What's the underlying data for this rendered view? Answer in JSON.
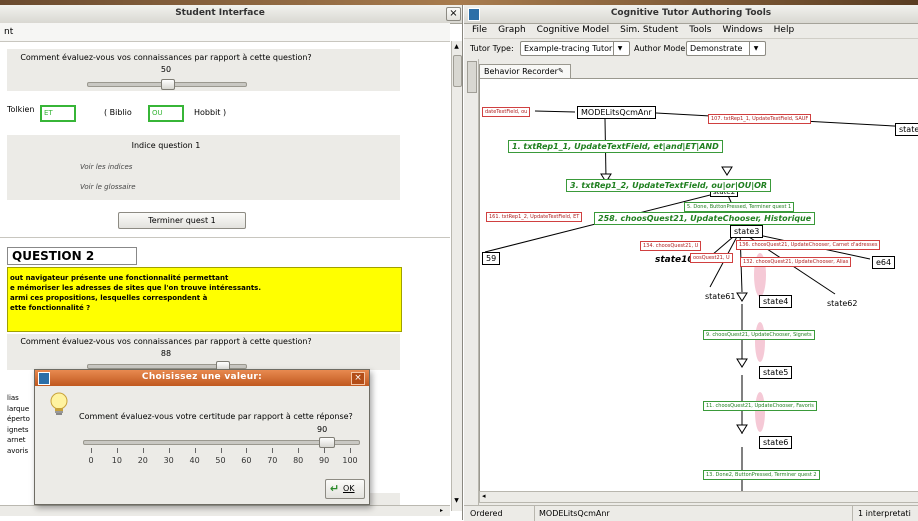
{
  "student": {
    "title": "Student Interface",
    "close_glyph": "×",
    "partial_tab": "nt",
    "q1": {
      "rating_prompt": "Comment évaluez-vous vos connaissances par rapport à cette question?",
      "rating_value": "50",
      "rating_level": 0.5,
      "tolkien": "Tolkien",
      "field1": "ET",
      "biblio": "(  Biblio",
      "field2": "OU",
      "hobbit": "Hobbit  )",
      "hint_title": "Indice question 1",
      "hint_link": "Voir les indices",
      "glossary_link": "Voir le glossaire",
      "finish_button": "Terminer quest 1"
    },
    "q2": {
      "heading": "QUESTION 2",
      "text_lines": [
        "out navigateur présente une fonctionnalité permettant",
        "e mémoriser les adresses de sites que l'on trouve intéressants.",
        "armi ces propositions, lesquelles correspondent à",
        "ette fonctionnalité ?"
      ],
      "rating_prompt": "Comment évaluez-vous vos connaissances par rapport à cette question?",
      "rating_value": "88",
      "rating_level": 0.88,
      "options": [
        "lias",
        "larque",
        "éperto",
        "ignets",
        "arnet",
        "avoris"
      ]
    }
  },
  "dialog": {
    "title": "Choisissez une valeur:",
    "close_glyph": "×",
    "question": "Comment évaluez-vous votre certitude par rapport à cette réponse?",
    "value": "90",
    "level": 0.9,
    "ticks": [
      "0",
      "10",
      "20",
      "30",
      "40",
      "50",
      "60",
      "70",
      "80",
      "90",
      "100"
    ],
    "ok_label": "OK"
  },
  "ctat": {
    "title": "Cognitive Tutor Authoring Tools",
    "menu": [
      "File",
      "Graph",
      "Cognitive Model",
      "Sim. Student",
      "Tools",
      "Windows",
      "Help"
    ],
    "tutor_type_label": "Tutor Type:",
    "tutor_type_value": "Example-tracing Tutor",
    "author_mode_label": "Author Mode:",
    "author_mode_value": "Demonstrate",
    "tab_label": "Behavior Recorder",
    "status": {
      "left": "Ordered",
      "middle": "MODELitsQcmAnr",
      "right": "1 interpretati"
    },
    "graph": {
      "nodes": {
        "root": "MODELitsQcmAnr",
        "state_right": "state",
        "state2": "state2",
        "state3": "state3",
        "state105": "state105",
        "n59": "59",
        "state64": "e64",
        "state61": "state61",
        "state4": "state4",
        "state62": "state62",
        "state5": "state5",
        "state6": "state6"
      },
      "edges": {
        "e_left_top": "dateTextField, ou",
        "e107": "107. txtRep1_1, UpdateTextField, SAUF",
        "e1": "1. txtRep1_1, UpdateTextField, et|and|ET|AND",
        "e3": "3. txtRep1_2, UpdateTextField, ou|or|OU|OR",
        "e5": "5. Done, ButtonPressed, Terminer quest 1",
        "e161": "161. txtRep1_2, UpdateTextField, ET",
        "e258": "258. choosQuest21, UpdateChooser, Historique",
        "e134": "134. choosQuest21, U",
        "e136": "136. choosQuest21, UpdateChooser, Carnet d'adresses",
        "e_mid": "oosQuest21, U",
        "e132": "132. choosQuest21, UpdateChooser, Alias",
        "e9": "9. choosQuest21, UpdateChooser, Signets",
        "e11": "11. choosQuest21, UpdateChooser, Favoris",
        "e13": "13. Done2, ButtonPressed, Terminer quest 2"
      }
    }
  },
  "colors": {
    "green": "#37b537",
    "q2_yellow": "#ffff00",
    "dialog_title_orange": "#d66a2a",
    "graph_green": "#1f7f1f",
    "graph_red": "#b02020"
  }
}
